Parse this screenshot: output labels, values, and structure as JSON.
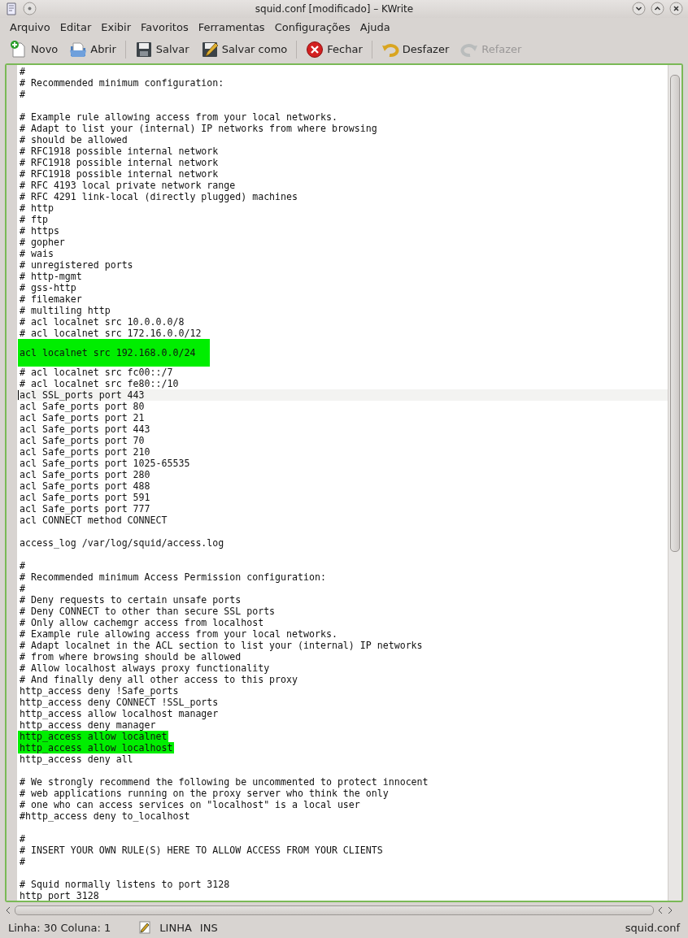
{
  "window": {
    "title": "squid.conf [modificado] – KWrite"
  },
  "menu": [
    "Arquivo",
    "Editar",
    "Exibir",
    "Favoritos",
    "Ferramentas",
    "Configurações",
    "Ajuda"
  ],
  "toolbar": [
    {
      "kind": "new",
      "label": "Novo",
      "disabled": false
    },
    {
      "kind": "open",
      "label": "Abrir",
      "disabled": false
    },
    {
      "kind": "save",
      "label": "Salvar",
      "disabled": false
    },
    {
      "kind": "saveas",
      "label": "Salvar como",
      "disabled": false
    },
    {
      "kind": "close",
      "label": "Fechar",
      "disabled": false
    },
    {
      "kind": "undo",
      "label": "Desfazer",
      "disabled": false
    },
    {
      "kind": "redo",
      "label": "Refazer",
      "disabled": true
    }
  ],
  "editor": {
    "lines": [
      {
        "kind": "text",
        "text": "#",
        "highlighted": false,
        "current": false
      },
      {
        "kind": "text",
        "text": "# Recommended minimum configuration:",
        "highlighted": false,
        "current": false
      },
      {
        "kind": "text",
        "text": "#",
        "highlighted": false,
        "current": false
      },
      {
        "kind": "blank"
      },
      {
        "kind": "text",
        "text": "# Example rule allowing access from your local networks.",
        "highlighted": false,
        "current": false
      },
      {
        "kind": "text",
        "text": "# Adapt to list your (internal) IP networks from where browsing",
        "highlighted": false,
        "current": false
      },
      {
        "kind": "text",
        "text": "# should be allowed",
        "highlighted": false,
        "current": false
      },
      {
        "kind": "text",
        "text": "# RFC1918 possible internal network",
        "highlighted": false,
        "current": false
      },
      {
        "kind": "text",
        "text": "# RFC1918 possible internal network",
        "highlighted": false,
        "current": false
      },
      {
        "kind": "text",
        "text": "# RFC1918 possible internal network",
        "highlighted": false,
        "current": false
      },
      {
        "kind": "text",
        "text": "# RFC 4193 local private network range",
        "highlighted": false,
        "current": false
      },
      {
        "kind": "text",
        "text": "# RFC 4291 link-local (directly plugged) machines",
        "highlighted": false,
        "current": false
      },
      {
        "kind": "text",
        "text": "# http",
        "highlighted": false,
        "current": false
      },
      {
        "kind": "text",
        "text": "# ftp",
        "highlighted": false,
        "current": false
      },
      {
        "kind": "text",
        "text": "# https",
        "highlighted": false,
        "current": false
      },
      {
        "kind": "text",
        "text": "# gopher",
        "highlighted": false,
        "current": false
      },
      {
        "kind": "text",
        "text": "# wais",
        "highlighted": false,
        "current": false
      },
      {
        "kind": "text",
        "text": "# unregistered ports",
        "highlighted": false,
        "current": false
      },
      {
        "kind": "text",
        "text": "# http-mgmt",
        "highlighted": false,
        "current": false
      },
      {
        "kind": "text",
        "text": "# gss-http",
        "highlighted": false,
        "current": false
      },
      {
        "kind": "text",
        "text": "# filemaker",
        "highlighted": false,
        "current": false
      },
      {
        "kind": "text",
        "text": "# multiling http",
        "highlighted": false,
        "current": false
      },
      {
        "kind": "text",
        "text": "# acl localnet src 10.0.0.0/8",
        "highlighted": false,
        "current": false
      },
      {
        "kind": "text",
        "text": "# acl localnet src 172.16.0.0/12",
        "highlighted": false,
        "current": false
      },
      {
        "kind": "block",
        "text": "acl localnet src 192.168.0.0/24",
        "highlighted": true,
        "current": false
      },
      {
        "kind": "text",
        "text": "# acl localnet src fc00::/7",
        "highlighted": false,
        "current": false
      },
      {
        "kind": "text",
        "text": "# acl localnet src fe80::/10",
        "highlighted": false,
        "current": false
      },
      {
        "kind": "text",
        "text": "acl SSL_ports port 443",
        "highlighted": false,
        "current": true
      },
      {
        "kind": "text",
        "text": "acl Safe_ports port 80",
        "highlighted": false,
        "current": false
      },
      {
        "kind": "text",
        "text": "acl Safe_ports port 21",
        "highlighted": false,
        "current": false
      },
      {
        "kind": "text",
        "text": "acl Safe_ports port 443",
        "highlighted": false,
        "current": false
      },
      {
        "kind": "text",
        "text": "acl Safe_ports port 70",
        "highlighted": false,
        "current": false
      },
      {
        "kind": "text",
        "text": "acl Safe_ports port 210",
        "highlighted": false,
        "current": false
      },
      {
        "kind": "text",
        "text": "acl Safe_ports port 1025-65535",
        "highlighted": false,
        "current": false
      },
      {
        "kind": "text",
        "text": "acl Safe_ports port 280",
        "highlighted": false,
        "current": false
      },
      {
        "kind": "text",
        "text": "acl Safe_ports port 488",
        "highlighted": false,
        "current": false
      },
      {
        "kind": "text",
        "text": "acl Safe_ports port 591",
        "highlighted": false,
        "current": false
      },
      {
        "kind": "text",
        "text": "acl Safe_ports port 777",
        "highlighted": false,
        "current": false
      },
      {
        "kind": "text",
        "text": "acl CONNECT method CONNECT",
        "highlighted": false,
        "current": false
      },
      {
        "kind": "blank"
      },
      {
        "kind": "text",
        "text": "access_log /var/log/squid/access.log",
        "highlighted": false,
        "current": false
      },
      {
        "kind": "blank"
      },
      {
        "kind": "text",
        "text": "#",
        "highlighted": false,
        "current": false
      },
      {
        "kind": "text",
        "text": "# Recommended minimum Access Permission configuration:",
        "highlighted": false,
        "current": false
      },
      {
        "kind": "text",
        "text": "#",
        "highlighted": false,
        "current": false
      },
      {
        "kind": "text",
        "text": "# Deny requests to certain unsafe ports",
        "highlighted": false,
        "current": false
      },
      {
        "kind": "text",
        "text": "# Deny CONNECT to other than secure SSL ports",
        "highlighted": false,
        "current": false
      },
      {
        "kind": "text",
        "text": "# Only allow cachemgr access from localhost",
        "highlighted": false,
        "current": false
      },
      {
        "kind": "text",
        "text": "# Example rule allowing access from your local networks.",
        "highlighted": false,
        "current": false
      },
      {
        "kind": "text",
        "text": "# Adapt localnet in the ACL section to list your (internal) IP networks",
        "highlighted": false,
        "current": false
      },
      {
        "kind": "text",
        "text": "# from where browsing should be allowed",
        "highlighted": false,
        "current": false
      },
      {
        "kind": "text",
        "text": "# Allow localhost always proxy functionality",
        "highlighted": false,
        "current": false
      },
      {
        "kind": "text",
        "text": "# And finally deny all other access to this proxy",
        "highlighted": false,
        "current": false
      },
      {
        "kind": "text",
        "text": "http_access deny !Safe_ports",
        "highlighted": false,
        "current": false
      },
      {
        "kind": "text",
        "text": "http_access deny CONNECT !SSL_ports",
        "highlighted": false,
        "current": false
      },
      {
        "kind": "text",
        "text": "http_access allow localhost manager",
        "highlighted": false,
        "current": false
      },
      {
        "kind": "text",
        "text": "http_access deny manager",
        "highlighted": false,
        "current": false
      },
      {
        "kind": "text",
        "text": "http_access allow localnet",
        "highlighted": true,
        "current": false
      },
      {
        "kind": "text",
        "text": "http_access allow localhost",
        "highlighted": true,
        "current": false
      },
      {
        "kind": "text",
        "text": "http_access deny all",
        "highlighted": false,
        "current": false
      },
      {
        "kind": "blank"
      },
      {
        "kind": "text",
        "text": "# We strongly recommend the following be uncommented to protect innocent",
        "highlighted": false,
        "current": false
      },
      {
        "kind": "text",
        "text": "# web applications running on the proxy server who think the only",
        "highlighted": false,
        "current": false
      },
      {
        "kind": "text",
        "text": "# one who can access services on \"localhost\" is a local user",
        "highlighted": false,
        "current": false
      },
      {
        "kind": "text",
        "text": "#http_access deny to_localhost",
        "highlighted": false,
        "current": false
      },
      {
        "kind": "blank"
      },
      {
        "kind": "text",
        "text": "#",
        "highlighted": false,
        "current": false
      },
      {
        "kind": "text",
        "text": "# INSERT YOUR OWN RULE(S) HERE TO ALLOW ACCESS FROM YOUR CLIENTS",
        "highlighted": false,
        "current": false
      },
      {
        "kind": "text",
        "text": "#",
        "highlighted": false,
        "current": false
      },
      {
        "kind": "blank"
      },
      {
        "kind": "text",
        "text": "# Squid normally listens to port 3128",
        "highlighted": false,
        "current": false
      },
      {
        "kind": "text",
        "text": "http_port 3128",
        "highlighted": false,
        "current": false
      }
    ]
  },
  "status_bar": {
    "position": "Linha: 30 Coluna: 1",
    "modified": true,
    "mode": "LINHA",
    "insert": "INS",
    "file": "squid.conf"
  }
}
